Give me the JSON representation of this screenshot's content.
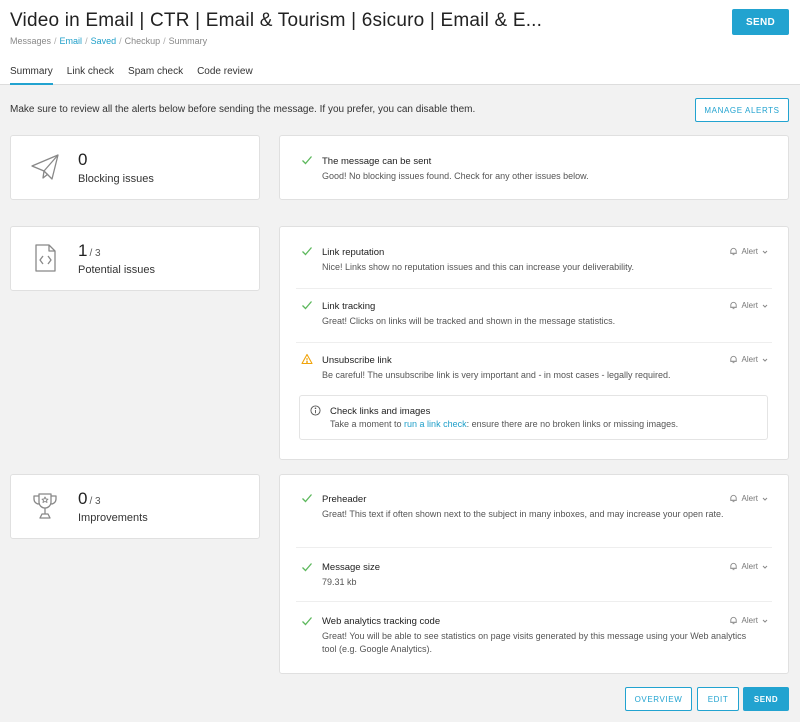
{
  "header": {
    "title": "Video in Email | CTR | Email & Tourism | 6sicuro | Email & E...",
    "breadcrumb": [
      "Messages",
      "Email",
      "Saved",
      "Checkup",
      "Summary"
    ],
    "send_label": "SEND"
  },
  "tabs": [
    "Summary",
    "Link check",
    "Spam check",
    "Code review"
  ],
  "notice": "Make sure to review all the alerts below before sending the message. If you prefer, you can disable them.",
  "manage_alerts_label": "MANAGE ALERTS",
  "blocking": {
    "count": "0",
    "label": "Blocking issues",
    "icon": "paper-plane-icon",
    "items": [
      {
        "title": "The message can be sent",
        "desc": "Good! No blocking issues found. Check for any other issues below."
      }
    ]
  },
  "potential": {
    "count": "1",
    "total": "/ 3",
    "label": "Potential issues",
    "icon": "code-file-icon",
    "items": [
      {
        "title": "Link reputation",
        "desc": "Nice! Links show no reputation issues and this can increase your deliverability.",
        "status": "ok",
        "alert": "Alert"
      },
      {
        "title": "Link tracking",
        "desc": "Great! Clicks on links will be tracked and shown in the message statistics.",
        "status": "ok",
        "alert": "Alert"
      },
      {
        "title": "Unsubscribe link",
        "desc": "Be careful! The unsubscribe link is very important and - in most cases - legally required.",
        "status": "warning",
        "alert": "Alert"
      }
    ],
    "info": {
      "title": "Check links and images",
      "desc_before": "Take a moment to ",
      "desc_link": "run a link check",
      "desc_after": ": ensure there are no broken links or missing images."
    }
  },
  "improvements": {
    "count": "0",
    "total": "/ 3",
    "label": "Improvements",
    "icon": "trophy-icon",
    "items": [
      {
        "title": "Preheader",
        "desc": "Great! This text if often shown next to the subject in many inboxes, and may increase your open rate.",
        "status": "ok",
        "alert": "Alert"
      },
      {
        "title": "Message size",
        "desc": "79.31 kb",
        "status": "ok",
        "alert": "Alert"
      },
      {
        "title": "Web analytics tracking code",
        "desc": "Great! You will be able to see statistics on page visits generated by this message using your Web analytics tool (e.g. Google Analytics).",
        "status": "ok",
        "alert": "Alert"
      }
    ]
  },
  "footer": {
    "overview_label": "OVERVIEW",
    "edit_label": "EDIT",
    "send_label": "SEND"
  },
  "colors": {
    "accent": "#22a3d0",
    "success": "#5cb85c",
    "warning": "#f0a30a"
  }
}
